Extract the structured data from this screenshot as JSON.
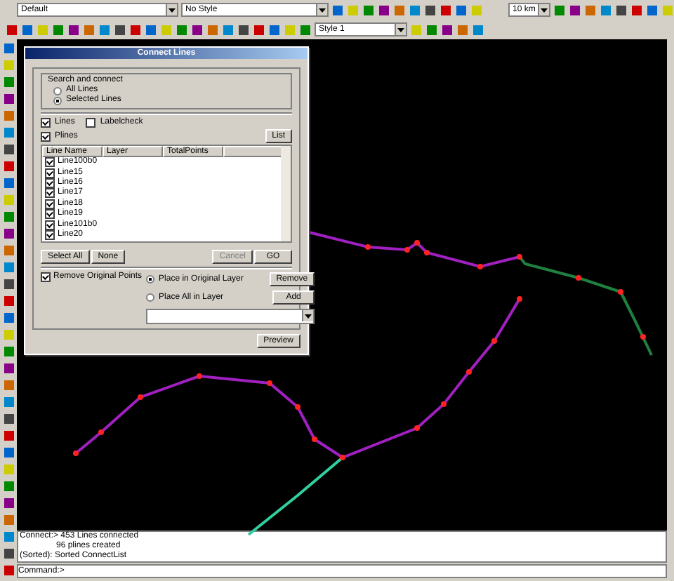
{
  "toolbar": {
    "layer": "Default",
    "style": "No Style",
    "scale": "10 km",
    "line_style": "Style 1"
  },
  "dialog": {
    "title": "Connect Lines",
    "search_group": "Search and connect",
    "search_options": [
      {
        "label": "All Lines",
        "selected": false
      },
      {
        "label": "Selected Lines",
        "selected": true
      }
    ],
    "filters": [
      {
        "label": "Lines",
        "checked": true
      },
      {
        "label": "Labelcheck",
        "checked": false
      },
      {
        "label": "Plines",
        "checked": true
      }
    ],
    "list_button": "List",
    "columns": [
      "Line Name",
      "Layer",
      "TotalPoints"
    ],
    "rows": [
      {
        "name": "Line100b0",
        "checked": true
      },
      {
        "name": "Line15",
        "checked": true
      },
      {
        "name": "Line16",
        "checked": true
      },
      {
        "name": "Line17",
        "checked": true
      },
      {
        "name": "Line18",
        "checked": true
      },
      {
        "name": "Line19",
        "checked": true
      },
      {
        "name": "Line101b0",
        "checked": true
      },
      {
        "name": "Line20",
        "checked": true
      }
    ],
    "left_buttons": [
      {
        "label": "Select All",
        "disabled": false
      },
      {
        "label": "None",
        "disabled": false
      }
    ],
    "right_buttons": [
      {
        "label": "Cancel",
        "disabled": true
      },
      {
        "label": "GO",
        "disabled": false
      }
    ],
    "remove_points": {
      "label": "Remove Original Points",
      "checked": true
    },
    "place_options": [
      {
        "label": "Place in Original Layer",
        "selected": true
      },
      {
        "label": "Place All in Layer",
        "selected": false
      }
    ],
    "side_buttons": [
      "Remove",
      "Add"
    ],
    "preview_button": "Preview"
  },
  "console": {
    "lines": [
      "Connect:>  453 Lines connected",
      "96 plines created",
      "(Sorted):  Sorted ConnectList"
    ],
    "command": "Command:>"
  }
}
